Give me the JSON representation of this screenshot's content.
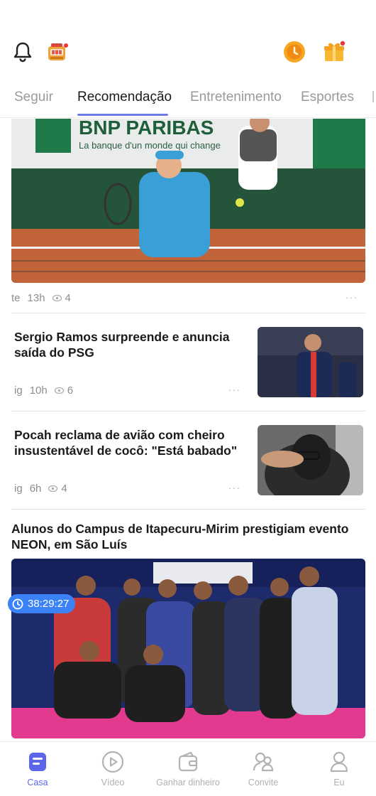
{
  "tabs": [
    "Seguir",
    "Recomendação",
    "Entretenimento",
    "Esportes"
  ],
  "active_tab": "Recomendação",
  "feed": {
    "hero": {
      "banner_text": "BNP PARIBAS",
      "banner_sub": "La banque d'un monde qui change",
      "source": "te",
      "time": "13h",
      "views": "4"
    },
    "items": [
      {
        "title": "Sergio Ramos surpreende e anuncia saída do PSG",
        "source": "ig",
        "time": "10h",
        "views": "6"
      },
      {
        "title": "Pocah reclama de avião com cheiro insustentável de cocô: \"Está babado\"",
        "source": "ig",
        "time": "6h",
        "views": "4"
      }
    ],
    "video": {
      "title": "Alunos do Campus de Itapecuru-Mirim prestigiam evento NEON, em São Luís",
      "duration": "38:29:27"
    }
  },
  "bottom_nav": [
    {
      "label": "Casa",
      "icon": "home-icon",
      "active": true
    },
    {
      "label": "Vídeo",
      "icon": "play-icon",
      "active": false
    },
    {
      "label": "Ganhar dinheiro",
      "icon": "wallet-icon",
      "active": false
    },
    {
      "label": "Convite",
      "icon": "invite-icon",
      "active": false
    },
    {
      "label": "Eu",
      "icon": "profile-icon",
      "active": false
    }
  ],
  "colors": {
    "accent": "#5b66e8",
    "timer": "#3b82f6",
    "coin": "#f5a623",
    "gift": "#f7b733"
  }
}
